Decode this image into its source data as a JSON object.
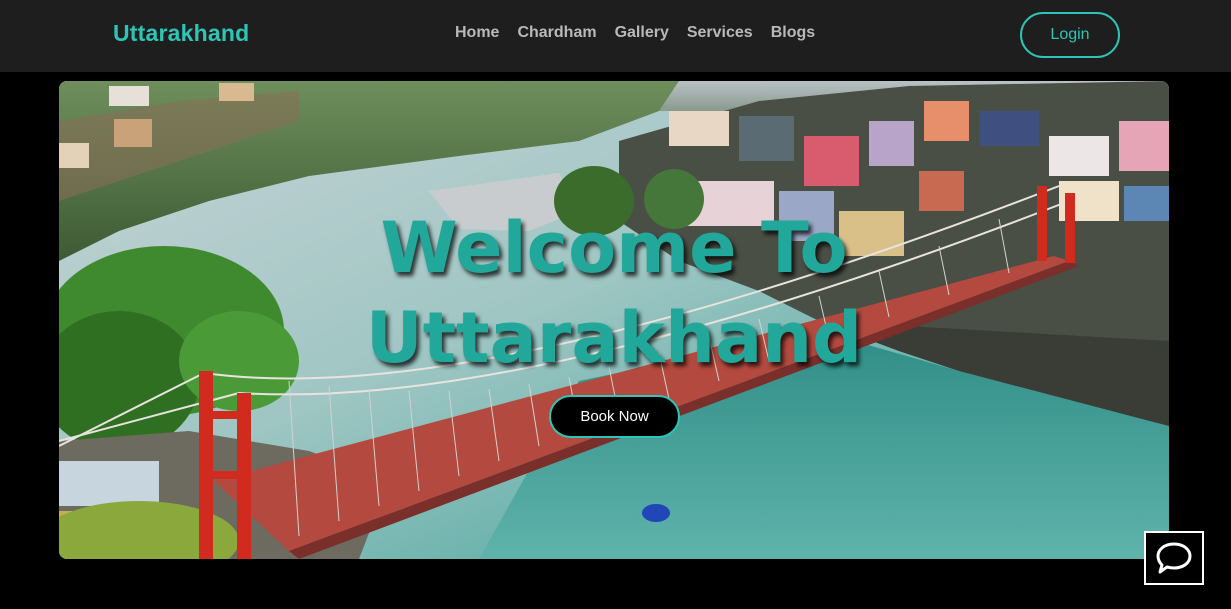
{
  "header": {
    "brand": "Uttarakhand",
    "nav": [
      {
        "label": "Home"
      },
      {
        "label": "Chardham"
      },
      {
        "label": "Gallery"
      },
      {
        "label": "Services"
      },
      {
        "label": "Blogs"
      }
    ],
    "login_label": "Login"
  },
  "hero": {
    "title_line1": "Welcome To",
    "title_line2": "Uttarakhand",
    "book_label": "Book Now",
    "image": "river-suspension-bridge-photo"
  },
  "chat": {
    "icon": "chat-bubble-icon"
  },
  "colors": {
    "accent": "#2ec4b6",
    "title": "#22a89a",
    "nav_bg": "#1e1e1e",
    "page_bg": "#000000",
    "nav_text": "#b9b9b9"
  }
}
